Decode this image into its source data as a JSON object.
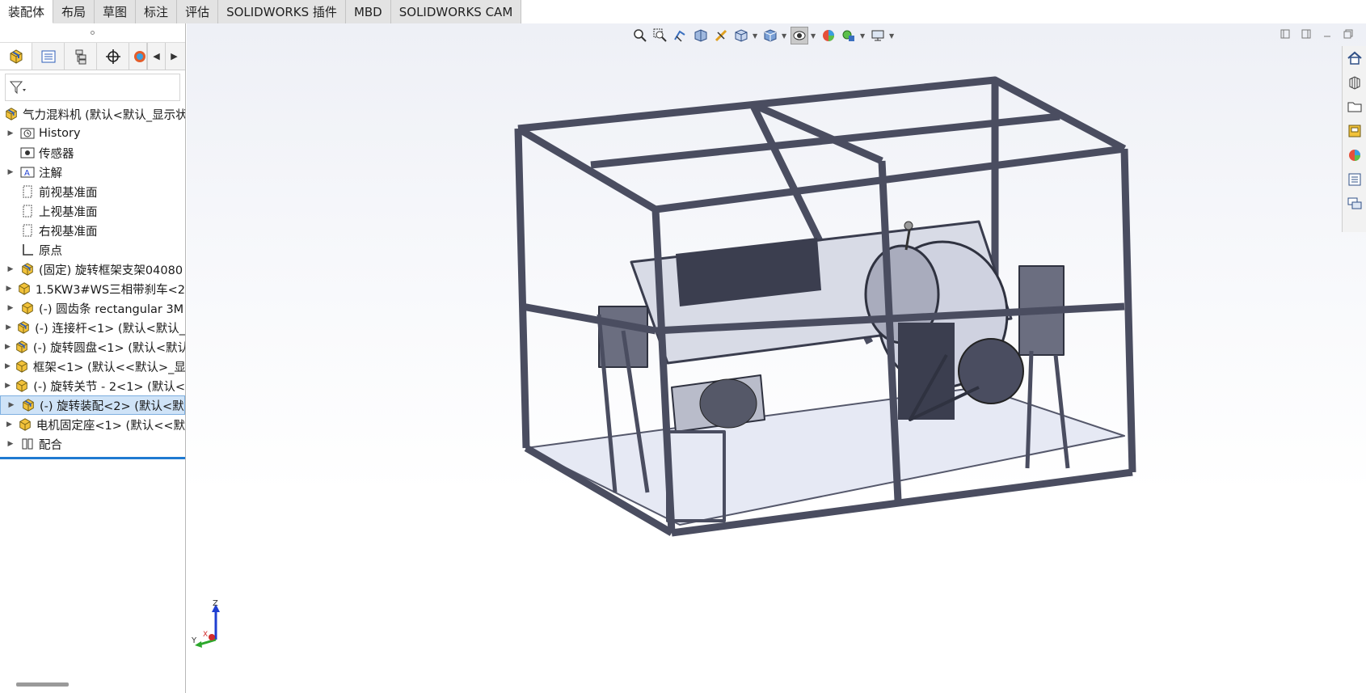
{
  "command_tabs": [
    "装配体",
    "布局",
    "草图",
    "标注",
    "评估",
    "SOLIDWORKS 插件",
    "MBD",
    "SOLIDWORKS CAM"
  ],
  "active_tab": "装配体",
  "feature_tree": {
    "root": "气力混料机 (默认<默认_显示状",
    "items": [
      {
        "label": "History",
        "icon": "history-icon",
        "expandable": true
      },
      {
        "label": "传感器",
        "icon": "sensor-icon",
        "expandable": false
      },
      {
        "label": "注解",
        "icon": "annotation-icon",
        "expandable": true
      },
      {
        "label": "前视基准面",
        "icon": "plane-icon",
        "expandable": false
      },
      {
        "label": "上视基准面",
        "icon": "plane-icon",
        "expandable": false
      },
      {
        "label": "右视基准面",
        "icon": "plane-icon",
        "expandable": false
      },
      {
        "label": "原点",
        "icon": "origin-icon",
        "expandable": false
      },
      {
        "label": "(固定) 旋转框架支架04080",
        "icon": "assembly-icon",
        "expandable": true
      },
      {
        "label": "1.5KW3#WS三相带刹车<2",
        "icon": "part-icon",
        "expandable": true
      },
      {
        "label": "(-) 圆齿条 rectangular 3M",
        "icon": "part-icon",
        "expandable": true
      },
      {
        "label": "(-) 连接杆<1> (默认<默认_",
        "icon": "assembly-icon",
        "expandable": true
      },
      {
        "label": "(-) 旋转圆盘<1> (默认<默认",
        "icon": "assembly-icon",
        "expandable": true
      },
      {
        "label": "框架<1> (默认<<默认>_显",
        "icon": "part-icon",
        "expandable": true
      },
      {
        "label": "(-) 旋转关节 - 2<1> (默认<",
        "icon": "part-icon",
        "expandable": true
      },
      {
        "label": "(-) 旋转装配<2> (默认<默",
        "icon": "assembly-icon",
        "expandable": true,
        "selected": true
      },
      {
        "label": "电机固定座<1> (默认<<默",
        "icon": "part-icon",
        "expandable": true
      },
      {
        "label": "配合",
        "icon": "mates-icon",
        "expandable": true
      }
    ]
  },
  "triad": {
    "x": "X",
    "y": "Y",
    "z": "Z"
  },
  "colors": {
    "accent": "#1f7ad1",
    "selection": "#cfe3f7",
    "frame": "#4a4d60"
  }
}
